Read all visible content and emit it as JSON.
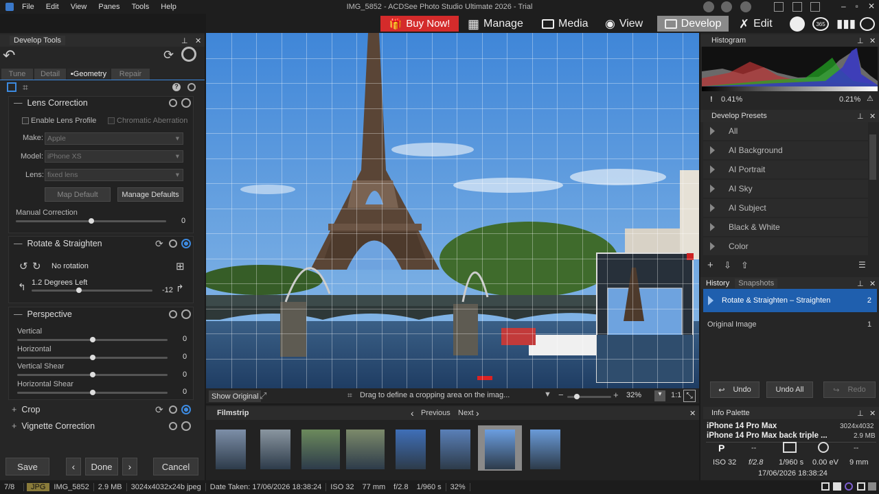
{
  "app": {
    "window_title": "IMG_5852 - ACDSee Photo Studio Ultimate 2026 - Trial",
    "menu": [
      "File",
      "Edit",
      "View",
      "Panes",
      "Tools",
      "Help"
    ]
  },
  "modes": {
    "buy_now": "Buy Now!",
    "manage": "Manage",
    "media": "Media",
    "view": "View",
    "develop": "Develop",
    "edit": "Edit",
    "badge_365": "365"
  },
  "left_panel": {
    "title": "Develop Tools",
    "tabs": [
      "Tune",
      "Detail",
      "Geometry",
      "Repair"
    ],
    "active_tab": "Geometry",
    "lens_correction": {
      "title": "Lens Correction",
      "enable_profile": "Enable Lens Profile",
      "chromatic": "Chromatic Aberration",
      "make_label": "Make:",
      "make_value": "Apple",
      "model_label": "Model:",
      "model_value": "iPhone XS",
      "lens_label": "Lens:",
      "lens_value": "fixed lens",
      "map_default": "Map Default",
      "manage_defaults": "Manage Defaults",
      "manual_label": "Manual Correction",
      "manual_value": "0",
      "manual_level": 0.5
    },
    "rotate": {
      "title": "Rotate & Straighten",
      "no_rotation": "No rotation",
      "degrees_label": "1.2 Degrees Left",
      "degrees_value": "-12",
      "degrees_level": 0.39
    },
    "perspective": {
      "title": "Perspective",
      "sliders": [
        {
          "label": "Vertical",
          "value": "0",
          "level": 0.5
        },
        {
          "label": "Horizontal",
          "value": "0",
          "level": 0.5
        },
        {
          "label": "Vertical Shear",
          "value": "0",
          "level": 0.5
        },
        {
          "label": "Horizontal Shear",
          "value": "0",
          "level": 0.5
        }
      ]
    },
    "crop": {
      "title": "Crop"
    },
    "vignette": {
      "title": "Vignette Correction"
    },
    "footer": {
      "save": "Save",
      "done": "Done",
      "cancel": "Cancel"
    }
  },
  "center": {
    "show_original": "Show Original",
    "hint": "Drag to define a cropping area on the imag...",
    "zoom": "32%",
    "one_to_one": "1:1"
  },
  "filmstrip": {
    "title": "Filmstrip",
    "previous": "Previous",
    "next": "Next",
    "thumb_count": 8,
    "selected_index": 6
  },
  "histogram": {
    "title": "Histogram",
    "left_value": "0.41%",
    "right_value": "0.21%"
  },
  "presets": {
    "title": "Develop Presets",
    "items": [
      "All",
      "AI Background",
      "AI Portrait",
      "AI Sky",
      "AI Subject",
      "Black & White",
      "Color"
    ]
  },
  "history": {
    "tab_history": "History",
    "tab_snapshots": "Snapshots",
    "items": [
      {
        "label": "Rotate & Straighten – Straighten",
        "num": "2"
      },
      {
        "label": "Original Image",
        "num": "1"
      }
    ],
    "undo": "Undo",
    "undo_all": "Undo All",
    "redo": "Redo"
  },
  "info": {
    "title": "Info Palette",
    "camera": "iPhone 14 Pro Max",
    "dimensions": "3024x4032",
    "lens": "iPhone 14 Pro Max back triple ...",
    "size": "2.9 MB",
    "mode": "P",
    "dash1": "--",
    "dash2": "--",
    "iso": "ISO 32",
    "aperture": "f/2.8",
    "shutter": "1/960 s",
    "ev": "0.00 eV",
    "focal": "9 mm",
    "date": "17/06/2026 18:38:24"
  },
  "status": {
    "index": "7/8",
    "format": "JPG",
    "filename": "IMG_5852",
    "size": "2.9 MB",
    "dims": "3024x4032x24b jpeg",
    "date_taken": "Date Taken: 17/06/2026 18:38:24",
    "iso": "ISO 32",
    "focal": "77 mm",
    "aperture": "f/2.8",
    "shutter": "1/960 s",
    "zoom": "32%"
  },
  "colors": {
    "accent": "#3d8ae0",
    "buy_now": "#d42b2b",
    "history_selected": "#1f5fae"
  }
}
